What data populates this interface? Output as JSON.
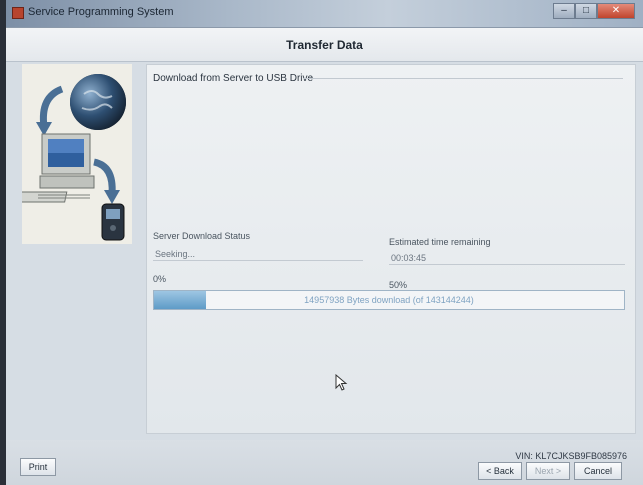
{
  "window": {
    "title": "Service Programming System",
    "controls": {
      "minimize": "–",
      "maximize": "□",
      "close": "✕"
    }
  },
  "dialog": {
    "title": "Transfer Data"
  },
  "transfer": {
    "group_label": "Download from Server to USB Drive",
    "status_label": "Server Download Status",
    "status_value": "Seeking...",
    "time_label": "Estimated time remaining",
    "time_value": "00:03:45",
    "progress_min_label": "0%",
    "progress_mid_label": "50%",
    "progress_fraction": 0.11,
    "progress_text": "14957938 Bytes download (of 143144244)"
  },
  "footer": {
    "vin": "VIN: KL7CJKSB9FB085976",
    "print_label": "Print",
    "back_label": "< Back",
    "next_label": "Next >",
    "cancel_label": "Cancel"
  },
  "icons": [
    "globe-icon",
    "computer-icon",
    "scan-tool-icon",
    "arrow-icon",
    "mouse-cursor-icon"
  ]
}
